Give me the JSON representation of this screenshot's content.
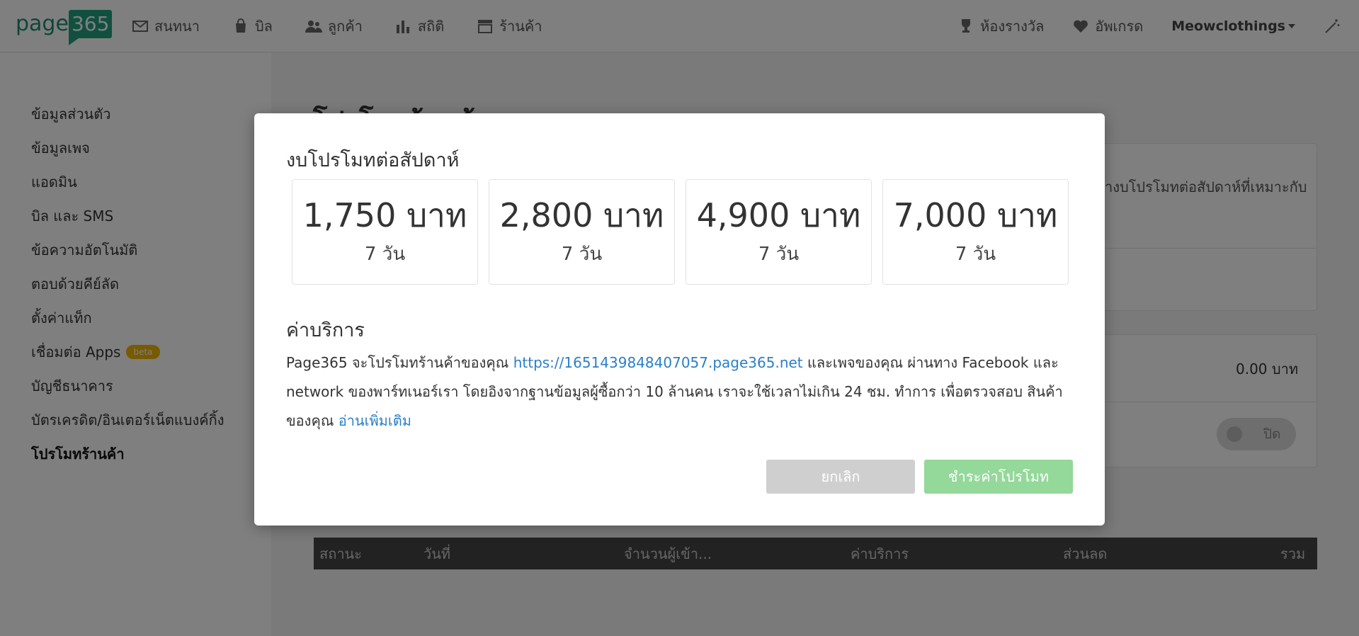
{
  "logo": {
    "text_page": "page",
    "text_num": "365"
  },
  "nav": {
    "left": [
      {
        "label": "สนทนา",
        "icon": "envelope-icon"
      },
      {
        "label": "บิล",
        "icon": "bag-icon"
      },
      {
        "label": "ลูกค้า",
        "icon": "users-icon"
      },
      {
        "label": "สถิติ",
        "icon": "bar-chart-icon"
      },
      {
        "label": "ร้านค้า",
        "icon": "store-icon"
      }
    ],
    "right": [
      {
        "label": "ห้องรางวัล",
        "icon": "trophy-icon"
      },
      {
        "label": "อัพเกรด",
        "icon": "heart-icon"
      }
    ],
    "store_name": "Meowclothings"
  },
  "sidebar": {
    "items": [
      {
        "label": "ข้อมูลส่วนตัว"
      },
      {
        "label": "ข้อมูลเพจ"
      },
      {
        "label": "แอดมิน"
      },
      {
        "label": "บิล และ SMS"
      },
      {
        "label": "ข้อความอัตโนมัติ"
      },
      {
        "label": "ตอบด้วยคีย์ลัด"
      },
      {
        "label": "ตั้งค่าแท็ก"
      },
      {
        "label": "เชื่อมต่อ Apps",
        "badge": "beta"
      },
      {
        "label": "บัญชีธนาคาร"
      },
      {
        "label": "บัตรเครดิต/อินเตอร์เน็ตแบงค์กิ้ง"
      },
      {
        "label": "โปรโมทร้านค้า",
        "active": true
      }
    ]
  },
  "main": {
    "title": "โปรโมทร้านค้า",
    "panel_text": "างบโปรโมทต่อสัปดาห์ที่เหมาะกับ",
    "amount": "0.00 บาท",
    "toggle_label": "ปิด",
    "table_headers": [
      "สถานะ",
      "วันที่",
      "จำนวนผู้เข้า...",
      "ค่าบริการ",
      "ส่วนลด",
      "รวม"
    ]
  },
  "modal": {
    "title": "งบโปรโมทต่อสัปดาห์",
    "packages": [
      {
        "price": "1,750 บาท",
        "days": "7 วัน"
      },
      {
        "price": "2,800 บาท",
        "days": "7 วัน"
      },
      {
        "price": "4,900 บาท",
        "days": "7 วัน"
      },
      {
        "price": "7,000 บาท",
        "days": "7 วัน"
      }
    ],
    "service_title": "ค่าบริการ",
    "desc_part1": "Page365 จะโปรโมทร้านค้าของคุณ ",
    "desc_link": "https://1651439848407057.page365.net",
    "desc_part2": " และเพจของคุณ ผ่านทาง Facebook และ network ของพาร์ทเนอร์เรา โดยอิงจากฐานข้อมูลผู้ซื้อกว่า 10 ล้านคน เราจะใช้เวลาไม่เกิน 24 ชม. ทำการ เพื่อตรวจสอบ สินค้าของคุณ ",
    "read_more": "อ่านเพิ่มเติม",
    "cancel_label": "ยกเลิก",
    "pay_label": "ชำระค่าโปรโมท"
  }
}
